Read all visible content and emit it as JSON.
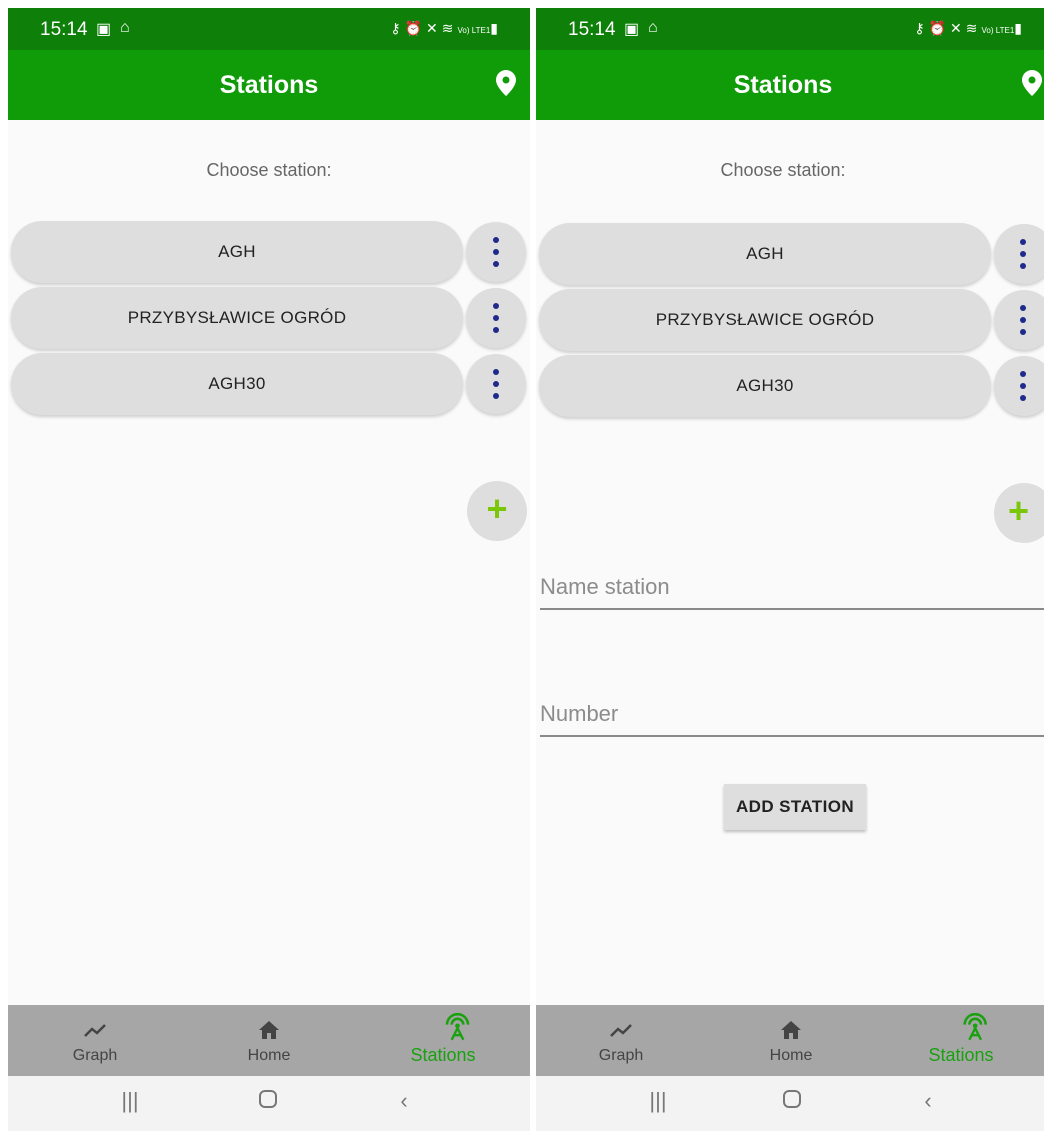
{
  "status_bar": {
    "time": "15:14",
    "network_label": "Vo) LTE1"
  },
  "screens": [
    {
      "app_bar": {
        "title": "Stations"
      },
      "choose_label": "Choose station:",
      "stations": [
        {
          "label": "AGH"
        },
        {
          "label": "PRZYBYSŁAWICE OGRÓD"
        },
        {
          "label": "AGH30"
        }
      ],
      "add_icon": "+",
      "bottom_nav": [
        {
          "label": "Graph",
          "icon": "graph-icon"
        },
        {
          "label": "Home",
          "icon": "home-icon"
        },
        {
          "label": "Stations",
          "icon": "antenna-icon",
          "active": true
        }
      ]
    },
    {
      "app_bar": {
        "title": "Stations"
      },
      "choose_label": "Choose station:",
      "stations": [
        {
          "label": "AGH"
        },
        {
          "label": "PRZYBYSŁAWICE OGRÓD"
        },
        {
          "label": "AGH30"
        }
      ],
      "add_icon": "+",
      "form": {
        "name_placeholder": "Name station",
        "number_placeholder": "Number",
        "submit_label": "ADD STATION"
      },
      "bottom_nav": [
        {
          "label": "Graph",
          "icon": "graph-icon"
        },
        {
          "label": "Home",
          "icon": "home-icon"
        },
        {
          "label": "Stations",
          "icon": "antenna-icon",
          "active": true
        }
      ]
    }
  ],
  "colors": {
    "status_bar": "#0e7f08",
    "app_bar": "#109b09",
    "active_nav": "#19a10f",
    "menu_dots": "#1f2a8a",
    "plus": "#7ac70a"
  }
}
